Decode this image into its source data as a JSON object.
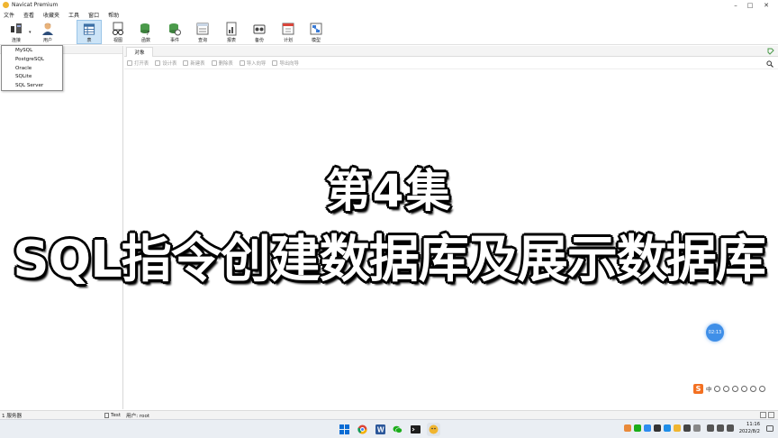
{
  "window": {
    "title": "Navicat Premium",
    "controls": [
      "–",
      "□",
      "✕"
    ]
  },
  "menu": [
    "文件",
    "查看",
    "收藏夹",
    "工具",
    "窗口",
    "帮助"
  ],
  "toolbar": [
    {
      "label": "连接",
      "icon": "connection-icon"
    },
    {
      "label": "用户",
      "icon": "user-icon"
    },
    {
      "label": "表",
      "icon": "table-icon"
    },
    {
      "label": "视图",
      "icon": "view-icon"
    },
    {
      "label": "函数",
      "icon": "function-icon"
    },
    {
      "label": "事件",
      "icon": "event-icon"
    },
    {
      "label": "查询",
      "icon": "query-icon"
    },
    {
      "label": "报表",
      "icon": "report-icon"
    },
    {
      "label": "备份",
      "icon": "backup-icon"
    },
    {
      "label": "计划",
      "icon": "schedule-icon"
    },
    {
      "label": "模型",
      "icon": "model-icon"
    }
  ],
  "dropdown": {
    "items": [
      "MySQL",
      "PostgreSQL",
      "Oracle",
      "SQLite",
      "SQL Server"
    ]
  },
  "objects": {
    "tab": "对象",
    "toolbar": [
      "打开表",
      "设计表",
      "新建表",
      "删除表",
      "导入向导",
      "导出向导"
    ]
  },
  "caption": {
    "line1": "第4集",
    "line2": "SQL指令创建数据库及展示数据库"
  },
  "clock_bubble": "02:13",
  "ime": {
    "logo": "S",
    "mode": "中"
  },
  "status": {
    "servers": "1 服务器",
    "connection": "Test",
    "user": "用户: root"
  },
  "taskbar": {
    "time": "11:16",
    "date": "2022/8/2"
  },
  "colors": {
    "accent": "#3f8fe8",
    "active_toolbar": "#cce4f7",
    "caption_fill": "#ffffff",
    "caption_outline": "#000000"
  }
}
